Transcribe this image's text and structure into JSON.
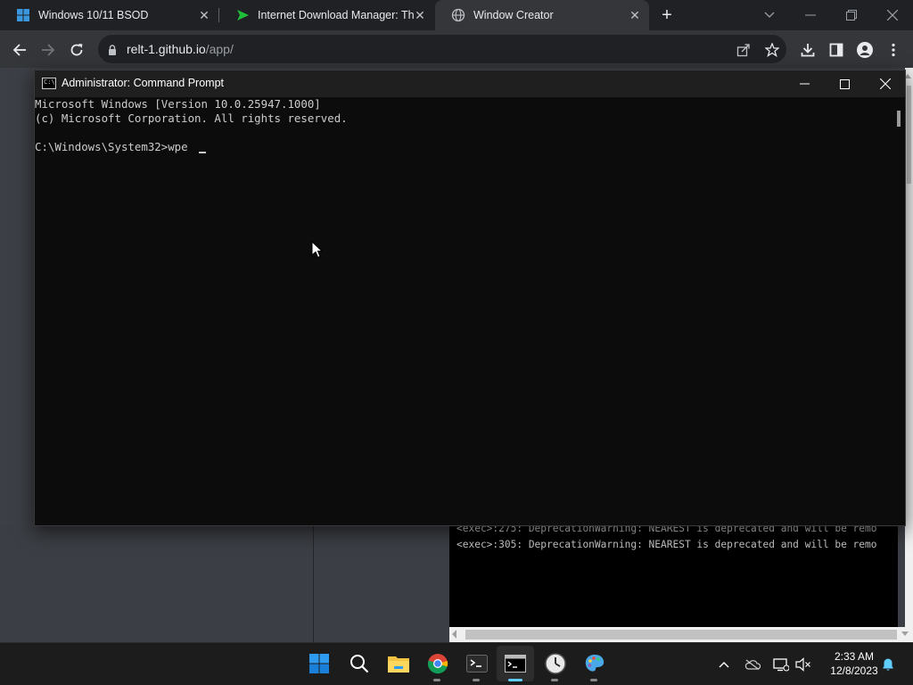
{
  "browser": {
    "tabs": [
      {
        "label": "Windows 10/11 BSOD",
        "icon": "windows-logo-icon",
        "active": false
      },
      {
        "label": "Internet Download Manager: The",
        "icon": "idm-arrow-icon",
        "active": false
      },
      {
        "label": "Window Creator",
        "icon": "globe-icon",
        "active": true
      }
    ],
    "new_tab_label": "+",
    "url_host": "relt-1.github.io",
    "url_path": "/app/"
  },
  "console": {
    "lines": [
      "<exec>:275: DeprecationWarning: NEAREST is deprecated and will be remo",
      "<exec>:305: DeprecationWarning: NEAREST is deprecated and will be remo"
    ]
  },
  "cmd_window": {
    "title": "Administrator: Command Prompt",
    "icon_text": "C:\\",
    "lines": [
      "Microsoft Windows [Version 10.0.25947.1000]",
      "(c) Microsoft Corporation. All rights reserved.",
      "",
      "C:\\Windows\\System32>wpe"
    ]
  },
  "taskbar": {
    "time": "2:33 AM",
    "date": "12/8/2023",
    "apps": [
      "start-icon",
      "search-icon",
      "file-explorer-icon",
      "chrome-icon",
      "terminal-icon",
      "command-prompt-icon",
      "clock-app-icon",
      "paint-icon"
    ]
  },
  "colors": {
    "chrome_frame": "#202124",
    "chrome_toolbar": "#35363a",
    "cmd_background": "#0c0c0c",
    "taskbar": "#1c1c1c",
    "accent": "#0078d4"
  }
}
